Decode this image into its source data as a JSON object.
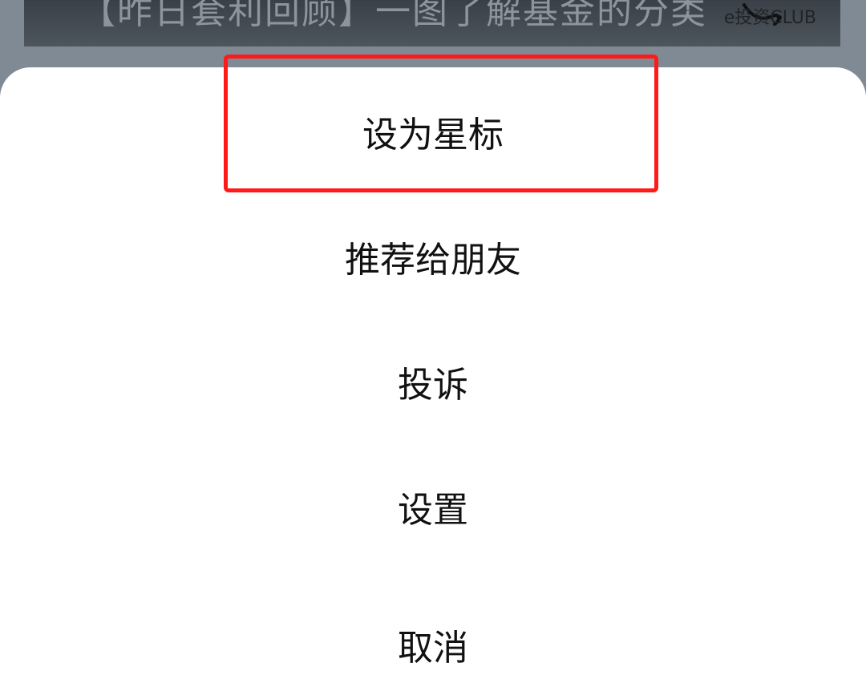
{
  "background": {
    "article_title": "【昨日套利回顾】一图了解基金的分类",
    "watermark": "e投资CLUB"
  },
  "action_sheet": {
    "items": [
      {
        "id": "star",
        "label": "设为星标"
      },
      {
        "id": "share",
        "label": "推荐给朋友"
      },
      {
        "id": "report",
        "label": "投诉"
      },
      {
        "id": "settings",
        "label": "设置"
      }
    ],
    "cancel_label": "取消"
  },
  "colors": {
    "sheet_background": "#ffffff",
    "overlay_dim": "#7f8a94",
    "highlight": "#ff1a1a",
    "text": "#111111"
  }
}
